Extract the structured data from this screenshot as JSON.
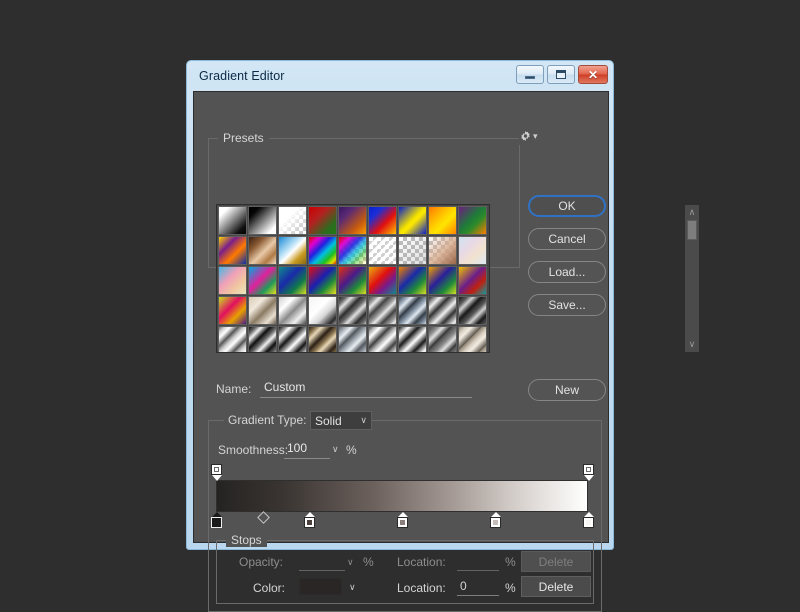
{
  "window": {
    "title": "Gradient Editor",
    "buttons": {
      "minimize": "minimize-button",
      "maximize": "maximize-button",
      "close": "✕"
    }
  },
  "presets": {
    "legend": "Presets",
    "gear_icon": "gear-icon",
    "caret": "▾",
    "scroll": {
      "up": "∧",
      "down": "∨"
    },
    "swatches": [
      {
        "n": "white-to-black",
        "css": "linear-gradient(135deg,#ffffff 0%,#ffffff 18%,#111111 82%,#000000 100%)"
      },
      {
        "n": "black-to-white",
        "css": "linear-gradient(135deg,#000000 0%,#050505 20%,#ffffff 85%,#ffffff 100%)"
      },
      {
        "n": "white-to-transparent",
        "alpha": true,
        "css": "linear-gradient(135deg,rgba(255,255,255,1) 0%,rgba(255,255,255,1) 35%,rgba(255,255,255,0) 100%)"
      },
      {
        "n": "red-to-green",
        "css": "linear-gradient(135deg,#cc0000 0%,#b52020 35%,#2e6b1f 75%,#1f7a14 100%)"
      },
      {
        "n": "violet-to-orange",
        "css": "linear-gradient(135deg,#3b1560 0%,#5a2a75 28%,#c45a10 70%,#ff9c00 100%)"
      },
      {
        "n": "blue-red-yellow",
        "css": "linear-gradient(135deg,#0a1fd0 0%,#1a2fd8 25%,#e01010 60%,#ffc000 100%)"
      },
      {
        "n": "blue-yellow-blue",
        "css": "linear-gradient(135deg,#0a1fc8 0%,#f0e000 48%,#ffe800 56%,#0a1fc8 100%)"
      },
      {
        "n": "orange-yellow-orange",
        "css": "linear-gradient(135deg,#ff7a00 0%,#ffd000 45%,#ffe400 60%,#ff8400 100%)"
      },
      {
        "n": "violet-green-orange",
        "css": "linear-gradient(135deg,#6d1f7e 0%,#1f7a3a 45%,#2a8a2a 62%,#ff7e00 100%)"
      },
      {
        "n": "yellow-violet-orange-blue",
        "css": "linear-gradient(135deg,#ffd400 0%,#7a1f8a 32%,#ff7a00 62%,#0a2fa8 100%)"
      },
      {
        "n": "copper",
        "css": "linear-gradient(135deg,#3a2012 0%,#8a5a33 28%,#e8c9a8 55%,#b07a45 78%,#f0ddc8 100%)"
      },
      {
        "n": "blue-white-gold",
        "css": "linear-gradient(135deg,#1e8ad6 0%,#bfe4f7 40%,#ffffff 52%,#c89a20 75%,#8a6a12 100%)"
      },
      {
        "n": "spectrum",
        "css": "linear-gradient(135deg,#e00000 0%,#e000d0 20%,#2020e0 40%,#00c0e0 58%,#20c020 76%,#e0e000 90%,#e02000 100%)"
      },
      {
        "n": "transparent-rainbow",
        "alpha": true,
        "css": "linear-gradient(135deg,rgba(224,0,0,1) 0%,rgba(224,0,208,0.95) 20%,rgba(32,32,224,0.9) 40%,rgba(0,192,224,0.7) 58%,rgba(32,192,32,0.5) 76%,rgba(224,224,0,0.25) 92%,rgba(224,32,0,0) 100%)"
      },
      {
        "n": "transparent-stripes",
        "alpha": true,
        "css": "repeating-linear-gradient(135deg,rgba(255,255,255,0.95) 0px,rgba(255,255,255,0.95) 3px,rgba(255,255,255,0.25) 3px,rgba(255,255,255,0.25) 6px)"
      },
      {
        "n": "transparent-gray",
        "alpha": true,
        "css": "linear-gradient(135deg,rgba(160,160,160,0.0) 0%,rgba(160,160,160,0.35) 100%)"
      },
      {
        "n": "skin-tone-transparent",
        "alpha": true,
        "css": "linear-gradient(135deg,rgba(244,222,205,0) 0%,rgba(214,170,140,0.85) 55%,rgba(150,96,64,0.95) 100%)"
      },
      {
        "n": "pastel-light",
        "css": "linear-gradient(135deg,#cfe3ef 0%,#e8d9e6 35%,#f2e2cf 65%,#dce9f2 100%)"
      },
      {
        "n": "pastel-blue-pink",
        "css": "linear-gradient(135deg,#46b6e6 0%,#f0a0b8 40%,#f0c8a0 70%,#eae6c0 100%)"
      },
      {
        "n": "cyan-magenta-yellow",
        "css": "linear-gradient(135deg,#00a8e0 0%,#e0209a 45%,#1f9a5a 72%,#e8e020 100%)"
      },
      {
        "n": "teal-blue-green",
        "css": "linear-gradient(135deg,#0f8a8a 0%,#1a2aa8 40%,#0f7a4a 70%,#d8e020 100%)"
      },
      {
        "n": "red-blue-yellow",
        "css": "linear-gradient(135deg,#e01010 0%,#1a20b0 45%,#1f8a3a 70%,#e8e020 100%)"
      },
      {
        "n": "orange-violet-yellow",
        "css": "linear-gradient(135deg,#e03010 0%,#4a1a8a 42%,#1f8a3a 70%,#dbe020 100%)"
      },
      {
        "n": "yellow-red-teal",
        "css": "linear-gradient(135deg,#e8b010 0%,#e01010 42%,#7a1a8a 66%,#0f8a8a 100%)"
      },
      {
        "n": "orange-blue-green",
        "css": "linear-gradient(135deg,#f08000 0%,#1a2aa8 42%,#1f8a3a 70%,#d8e020 100%)"
      },
      {
        "n": "amber-indigo-lime",
        "css": "linear-gradient(135deg,#f0a000 0%,#2a1f9a 42%,#1f8a3a 72%,#d0e020 100%)"
      },
      {
        "n": "gold-violet-teal",
        "css": "linear-gradient(135deg,#f0c000 0%,#6a1f8a 45%,#c02010 70%,#0f9a9a 100%)"
      },
      {
        "n": "lime-magenta-violet",
        "css": "linear-gradient(135deg,#c8e020 0%,#e01060 40%,#e8a000 68%,#4a1a8a 100%)"
      },
      {
        "n": "sand-metal",
        "css": "linear-gradient(135deg,#d8cbb4 0%,#f0e8dc 30%,#8a7a62 55%,#e8e0d2 80%,#6a5c48 100%)"
      },
      {
        "n": "silver-steel",
        "css": "linear-gradient(135deg,#cfcfcf 0%,#ffffff 28%,#8a8a8a 52%,#f0f0f0 76%,#4a4a4a 100%)"
      },
      {
        "n": "white-chrome",
        "css": "linear-gradient(135deg,#f4f4f4 0%,#ffffff 40%,#d8d8d8 62%,#2a2a2a 88%,#9a9a9a 100%)"
      },
      {
        "n": "dark-chrome-stripes",
        "css": "repeating-linear-gradient(135deg,#2a2a2a 0px,#6a6a6a 5px,#e0e0e0 9px,#3a3a3a 15px)"
      },
      {
        "n": "steel-bars",
        "css": "repeating-linear-gradient(135deg,#4a4a4a 0px,#9a9a9a 5px,#e8e8e8 8px,#3a3a3a 14px)"
      },
      {
        "n": "blue-steel",
        "css": "repeating-linear-gradient(135deg,#3a4450 0px,#8a98a8 5px,#dfe8f0 9px,#2a323c 15px)"
      },
      {
        "n": "polished-metal",
        "css": "repeating-linear-gradient(135deg,#2e2e2e 0px,#8a8a8a 4px,#f0f0f0 8px,#3a3a3a 14px)"
      },
      {
        "n": "dark-metal",
        "css": "repeating-linear-gradient(135deg,#1a1a1a 0px,#5a5a5a 6px,#d0d0d0 10px,#151515 16px)"
      },
      {
        "n": "chrome-light",
        "css": "repeating-linear-gradient(135deg,#6a6a6a 0px,#cfcfcf 4px,#ffffff 8px,#4a4a4a 14px)"
      },
      {
        "n": "black-chrome",
        "css": "repeating-linear-gradient(135deg,#0f0f0f 0px,#6a6a6a 5px,#f0f0f0 9px,#101010 15px)"
      },
      {
        "n": "silver-dark",
        "css": "repeating-linear-gradient(135deg,#141414 0px,#9a9a9a 5px,#ffffff 8px,#1a1a1a 15px)"
      },
      {
        "n": "bronze-metal",
        "css": "repeating-linear-gradient(135deg,#2a2014 0px,#8a7450 5px,#e8d8b8 9px,#2a2014 16px)"
      },
      {
        "n": "gray-steel",
        "css": "repeating-linear-gradient(135deg,#5a5f66 0px,#a8b0b8 5px,#e8eef2 9px,#4a4f56 15px)"
      },
      {
        "n": "light-chrome",
        "css": "repeating-linear-gradient(135deg,#4a4a4a 0px,#b0b0b0 4px,#ffffff 8px,#3a3a3a 15px)"
      },
      {
        "n": "chrome-contrast",
        "css": "repeating-linear-gradient(135deg,#1f1f1f 0px,#a0a0a0 4px,#ffffff 7px,#161616 14px)"
      },
      {
        "n": "muted-steel",
        "css": "repeating-linear-gradient(135deg,#4a4a4a 0px,#8a8a8a 6px,#e0e0e0 10px,#2a2a2a 16px)"
      },
      {
        "n": "warm-metal",
        "css": "repeating-linear-gradient(135deg,#8a8070 0px,#d8cfc0 5px,#f2ece2 9px,#5a5248 16px)"
      }
    ]
  },
  "side_buttons": {
    "ok": "OK",
    "cancel": "Cancel",
    "load": "Load...",
    "save": "Save...",
    "new": "New"
  },
  "name_row": {
    "label": "Name:",
    "value": "Custom"
  },
  "gradient_type": {
    "label": "Gradient Type:",
    "value": "Solid",
    "caret": "∨"
  },
  "smoothness": {
    "label": "Smoothness:",
    "value": "100",
    "caret": "∨",
    "unit": "%"
  },
  "gradient_bar": {
    "css": "linear-gradient(90deg,#252322 0%,#3a3532 18%,#6b605c 42%,#a09590 62%,#d8d2ce 82%,#ffffff 100%)",
    "opacity_stops": [
      {
        "name": "opacity-stop-0",
        "location": 0
      },
      {
        "name": "opacity-stop-100",
        "location": 100
      }
    ],
    "color_stops": [
      {
        "name": "color-stop-0",
        "location": 0,
        "color": "#1e1c1b",
        "selected": true
      },
      {
        "name": "color-stop-25",
        "location": 25,
        "color": "#4a403c"
      },
      {
        "name": "color-stop-50",
        "location": 50,
        "color": "#8a7f7b"
      },
      {
        "name": "color-stop-75",
        "location": 75,
        "color": "#c3bcb8"
      },
      {
        "name": "color-stop-100",
        "location": 100,
        "color": "#f7f5f4"
      }
    ],
    "midpoints": [
      {
        "name": "midpoint-12",
        "location": 12.5
      }
    ]
  },
  "stops": {
    "legend": "Stops",
    "opacity_label": "Opacity:",
    "opacity_value": "",
    "opacity_unit": "%",
    "opacity_location_label": "Location:",
    "opacity_location_value": "",
    "opacity_location_unit": "%",
    "opacity_delete": "Delete",
    "color_label": "Color:",
    "color_value": "#2a2625",
    "color_caret": "∨",
    "color_location_label": "Location:",
    "color_location_value": "0",
    "color_location_unit": "%",
    "color_delete": "Delete"
  }
}
